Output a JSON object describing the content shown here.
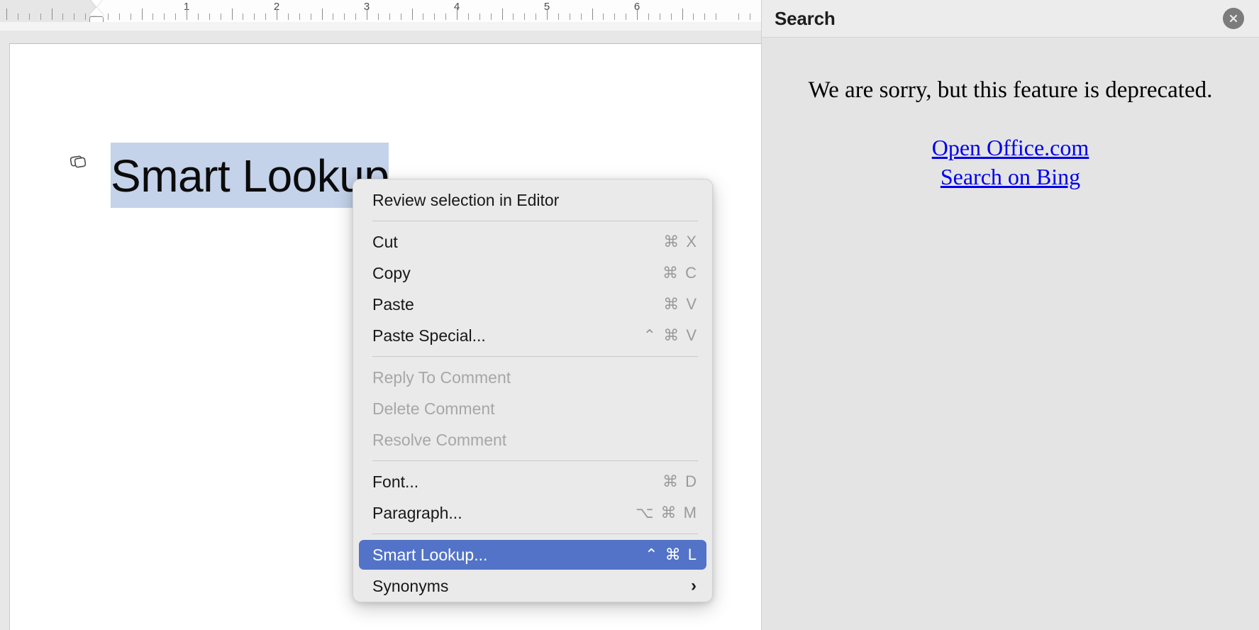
{
  "ruler": {
    "numbers": [
      "1",
      "2",
      "3",
      "4",
      "5",
      "6"
    ],
    "left_indent_marker": "first-line-indent-marker"
  },
  "document": {
    "heading_text": "Smart Lookup",
    "comment_icon": "comment-icon"
  },
  "context_menu": {
    "groups": [
      {
        "items": [
          {
            "label": "Review selection in Editor",
            "shortcut": "",
            "state": "enabled"
          }
        ]
      },
      {
        "items": [
          {
            "label": "Cut",
            "shortcut": "⌘ X",
            "state": "enabled"
          },
          {
            "label": "Copy",
            "shortcut": "⌘ C",
            "state": "enabled"
          },
          {
            "label": "Paste",
            "shortcut": "⌘ V",
            "state": "enabled"
          },
          {
            "label": "Paste Special...",
            "shortcut": "⌃ ⌘ V",
            "state": "enabled"
          }
        ]
      },
      {
        "items": [
          {
            "label": "Reply To Comment",
            "shortcut": "",
            "state": "disabled"
          },
          {
            "label": "Delete Comment",
            "shortcut": "",
            "state": "disabled"
          },
          {
            "label": "Resolve Comment",
            "shortcut": "",
            "state": "disabled"
          }
        ]
      },
      {
        "items": [
          {
            "label": "Font...",
            "shortcut": "⌘ D",
            "state": "enabled"
          },
          {
            "label": "Paragraph...",
            "shortcut": "⌥ ⌘ M",
            "state": "enabled"
          }
        ]
      },
      {
        "items": [
          {
            "label": "Smart Lookup...",
            "shortcut": "⌃ ⌘ L",
            "state": "selected"
          },
          {
            "label": "Synonyms",
            "shortcut": "",
            "state": "submenu",
            "submenu_arrow": "›"
          }
        ]
      }
    ],
    "highlight_color": "#5373c8"
  },
  "search_panel": {
    "title": "Search",
    "close_icon": "close-icon",
    "message": "We are sorry, but this feature is deprecated.",
    "links": [
      {
        "label": "Open Office.com"
      },
      {
        "label": "Search on Bing"
      }
    ],
    "link_color": "#0000ee"
  }
}
